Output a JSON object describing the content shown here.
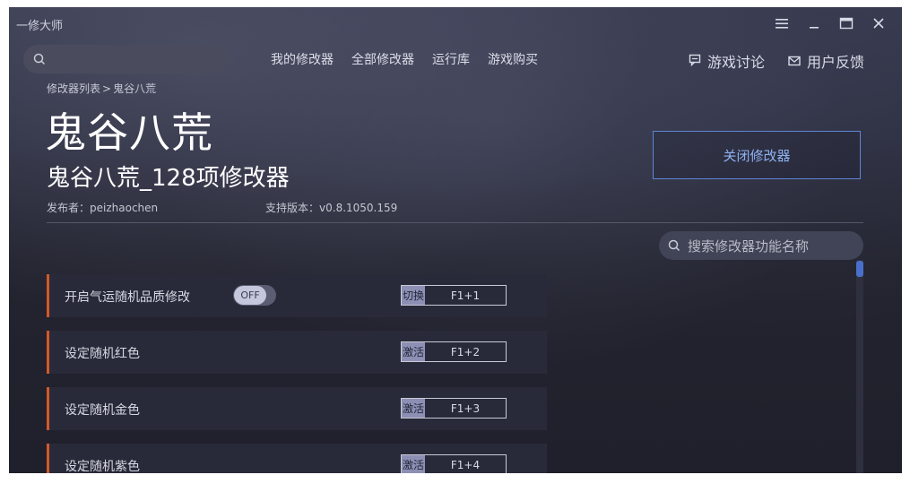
{
  "app": {
    "title": "一修大师"
  },
  "search": {
    "placeholder": ""
  },
  "nav": {
    "items": [
      "我的修改器",
      "全部修改器",
      "运行库",
      "游戏购买"
    ]
  },
  "header_links": {
    "discuss": "游戏讨论",
    "feedback": "用户反馈"
  },
  "breadcrumb": {
    "root": "修改器列表",
    "separator": ">",
    "current": "鬼谷八荒"
  },
  "game": {
    "title": "鬼谷八荒",
    "trainer_name": "鬼谷八荒_128项修改器",
    "author_label": "发布者：",
    "author": "peizhaochen",
    "version_label": "支持版本：",
    "version": "v0.8.1050.159"
  },
  "close_button": {
    "label": "关闭修改器"
  },
  "feature_search": {
    "placeholder": "搜索修改器功能名称"
  },
  "features": [
    {
      "label": "开启气运随机品质修改",
      "toggle": "OFF",
      "action": "切换",
      "key": "F1+1"
    },
    {
      "label": "设定随机红色",
      "action": "激活",
      "key": "F1+2"
    },
    {
      "label": "设定随机金色",
      "action": "激活",
      "key": "F1+3"
    },
    {
      "label": "设定随机紫色",
      "action": "激活",
      "key": "F1+4"
    }
  ],
  "colors": {
    "accent_orange": "#d4582a",
    "accent_blue": "#5d85d6"
  },
  "icons": {
    "search": "search-icon",
    "menu": "menu-icon",
    "minimize": "minimize-icon",
    "maximize": "maximize-icon",
    "close": "close-icon",
    "chat": "chat-icon",
    "mail": "mail-icon"
  }
}
